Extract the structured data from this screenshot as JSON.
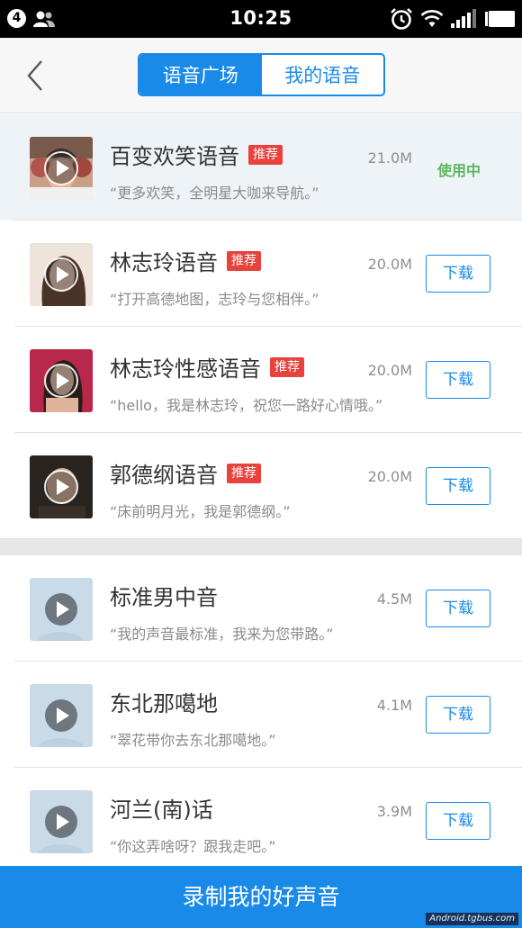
{
  "status_bar": {
    "notification_count": "4",
    "time": "10:25"
  },
  "header": {
    "tabs": [
      {
        "label": "语音广场",
        "active": true
      },
      {
        "label": "我的语音",
        "active": false
      }
    ]
  },
  "colors": {
    "accent": "#1a8ae8",
    "tag": "#e8423c",
    "in_use": "#5cb85c"
  },
  "voice_list": {
    "featured": [
      {
        "title": "百变欢笑语音",
        "tag": "推荐",
        "desc": "“更多欢笑，全明星大咖来导航。”",
        "size": "21.0M",
        "status": "使用中",
        "thumbnail_icon": "portrait-avatar-icon"
      },
      {
        "title": "林志玲语音",
        "tag": "推荐",
        "desc": "“打开高德地图，志玲与您相伴。”",
        "size": "20.0M",
        "action": "下载",
        "thumbnail_icon": "portrait-avatar-icon"
      },
      {
        "title": "林志玲性感语音",
        "tag": "推荐",
        "desc": "“hello，我是林志玲，祝您一路好心情哦。”",
        "size": "20.0M",
        "action": "下载",
        "thumbnail_icon": "portrait-avatar-icon"
      },
      {
        "title": "郭德纲语音",
        "tag": "推荐",
        "desc": "“床前明月光，我是郭德纲。”",
        "size": "20.0M",
        "action": "下载",
        "thumbnail_icon": "portrait-avatar-icon"
      }
    ],
    "standard": [
      {
        "title": "标准男中音",
        "desc": "“我的声音最标准，我来为您带路。”",
        "size": "4.5M",
        "action": "下载",
        "thumbnail_icon": "default-avatar-icon"
      },
      {
        "title": "东北那噶地",
        "desc": "“翠花带你去东北那噶地。”",
        "size": "4.1M",
        "action": "下载",
        "thumbnail_icon": "default-avatar-icon"
      },
      {
        "title": "河兰(南)话",
        "desc": "“你这弄啥呀？跟我走吧。”",
        "size": "3.9M",
        "action": "下载",
        "thumbnail_icon": "default-avatar-icon"
      }
    ]
  },
  "bottom_button": {
    "label": "录制我的好声音"
  },
  "watermark": "Android.tgbus.com"
}
